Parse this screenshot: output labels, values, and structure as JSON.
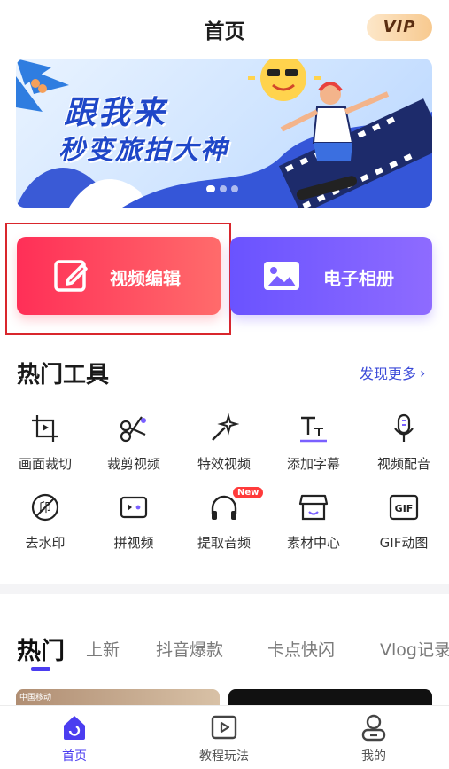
{
  "header": {
    "title": "首页",
    "vip_label": "VIP"
  },
  "banner": {
    "line1": "跟我来",
    "line2": "秒变旅拍大神",
    "slide_count": 3,
    "active_slide": 1
  },
  "actions": {
    "video_edit": "视频编辑",
    "photo_album": "电子相册"
  },
  "hot_tools": {
    "title": "热门工具",
    "more": "发现更多",
    "items": [
      {
        "label": "画面裁切",
        "icon": "crop-frame-icon"
      },
      {
        "label": "裁剪视频",
        "icon": "scissors-icon"
      },
      {
        "label": "特效视频",
        "icon": "magic-wand-icon"
      },
      {
        "label": "添加字幕",
        "icon": "text-subtitle-icon"
      },
      {
        "label": "视频配音",
        "icon": "microphone-icon"
      },
      {
        "label": "去水印",
        "icon": "watermark-remove-icon"
      },
      {
        "label": "拼视频",
        "icon": "video-merge-icon"
      },
      {
        "label": "提取音频",
        "icon": "headphones-icon",
        "badge": "New"
      },
      {
        "label": "素材中心",
        "icon": "store-icon"
      },
      {
        "label": "GIF动图",
        "icon": "gif-icon"
      }
    ]
  },
  "category_tabs": [
    "热门",
    "上新",
    "抖音爆款",
    "卡点快闪",
    "Vlog记录"
  ],
  "thumbnails": {
    "left_status": "中国移动"
  },
  "bottom_nav": [
    {
      "label": "首页",
      "icon": "home-icon",
      "active": true
    },
    {
      "label": "教程玩法",
      "icon": "tutorial-play-icon",
      "active": false
    },
    {
      "label": "我的",
      "icon": "profile-icon",
      "active": false
    }
  ],
  "colors": {
    "accent": "#4b3df0",
    "video_card": "#ff2f57",
    "album_card": "#6a53ff",
    "highlight": "#d9262c"
  }
}
